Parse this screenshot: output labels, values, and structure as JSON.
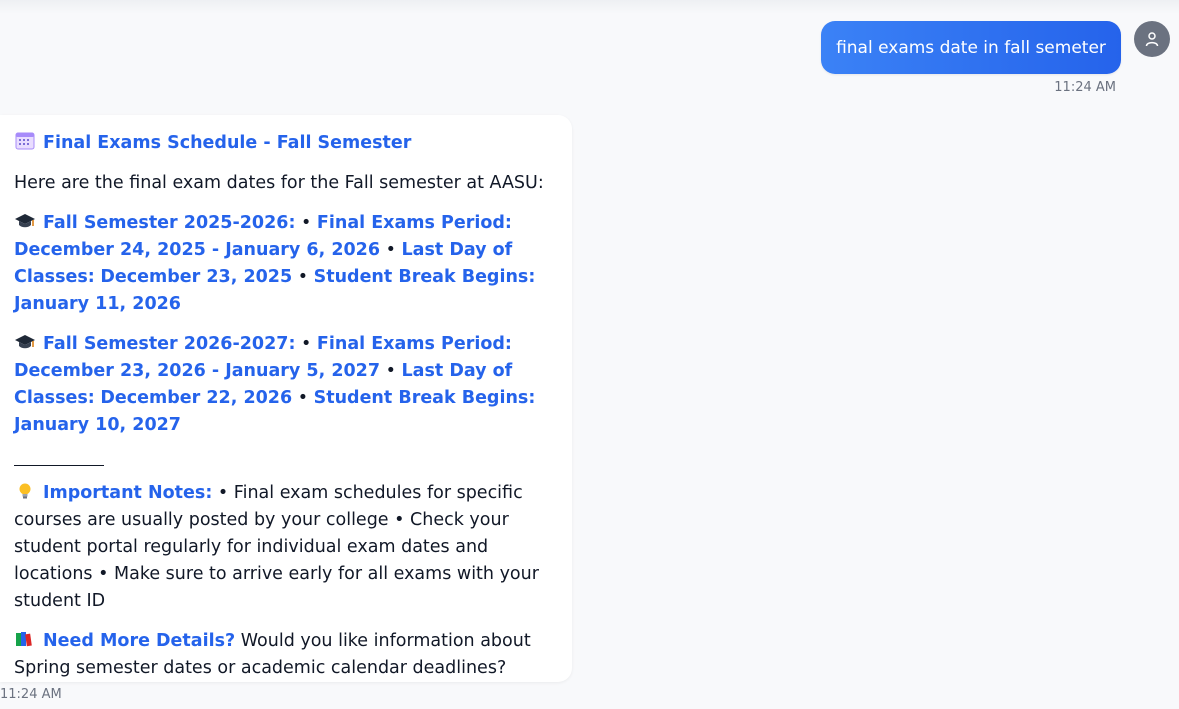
{
  "user_message": {
    "text": "final exams date in fall semeter",
    "time": "11:24 AM"
  },
  "assistant_message": {
    "time": "11:24 AM",
    "title": "Final Exams Schedule - Fall Semester",
    "intro": "Here are the final exam dates for the Fall semester at AASU:",
    "sem1": {
      "label": "Fall Semester 2025-2026:",
      "exams_label": "Final Exams Period:",
      "exams_value": "December 24, 2025 - January 6, 2026",
      "last_day_label": "Last Day of Classes:",
      "last_day_value": "December 23, 2025",
      "break_label": "Student Break Begins:",
      "break_value": "January 11, 2026"
    },
    "sem2": {
      "label": "Fall Semester 2026-2027:",
      "exams_label": "Final Exams Period:",
      "exams_value": "December 23, 2026 - January 5, 2027",
      "last_day_label": "Last Day of Classes:",
      "last_day_value": "December 22, 2026",
      "break_label": "Student Break Begins:",
      "break_value": "January 10, 2027"
    },
    "separator": "___________",
    "notes": {
      "label": "Important Notes:",
      "items": [
        "Final exam schedules for specific courses are usually posted by your college",
        "Check your student portal regularly for individual exam dates and locations",
        "Make sure to arrive early for all exams with your student ID"
      ]
    },
    "more": {
      "label": "Need More Details?",
      "text": "Would you like information about Spring semester dates or academic calendar deadlines?"
    }
  },
  "colors": {
    "accent": "#2563eb",
    "user_bubble": "#3b82f6",
    "background": "#f8f9fb",
    "avatar": "#6b7280"
  },
  "icons": [
    "calendar-icon",
    "graduation-cap-icon",
    "lightbulb-icon",
    "books-icon",
    "user-icon"
  ]
}
